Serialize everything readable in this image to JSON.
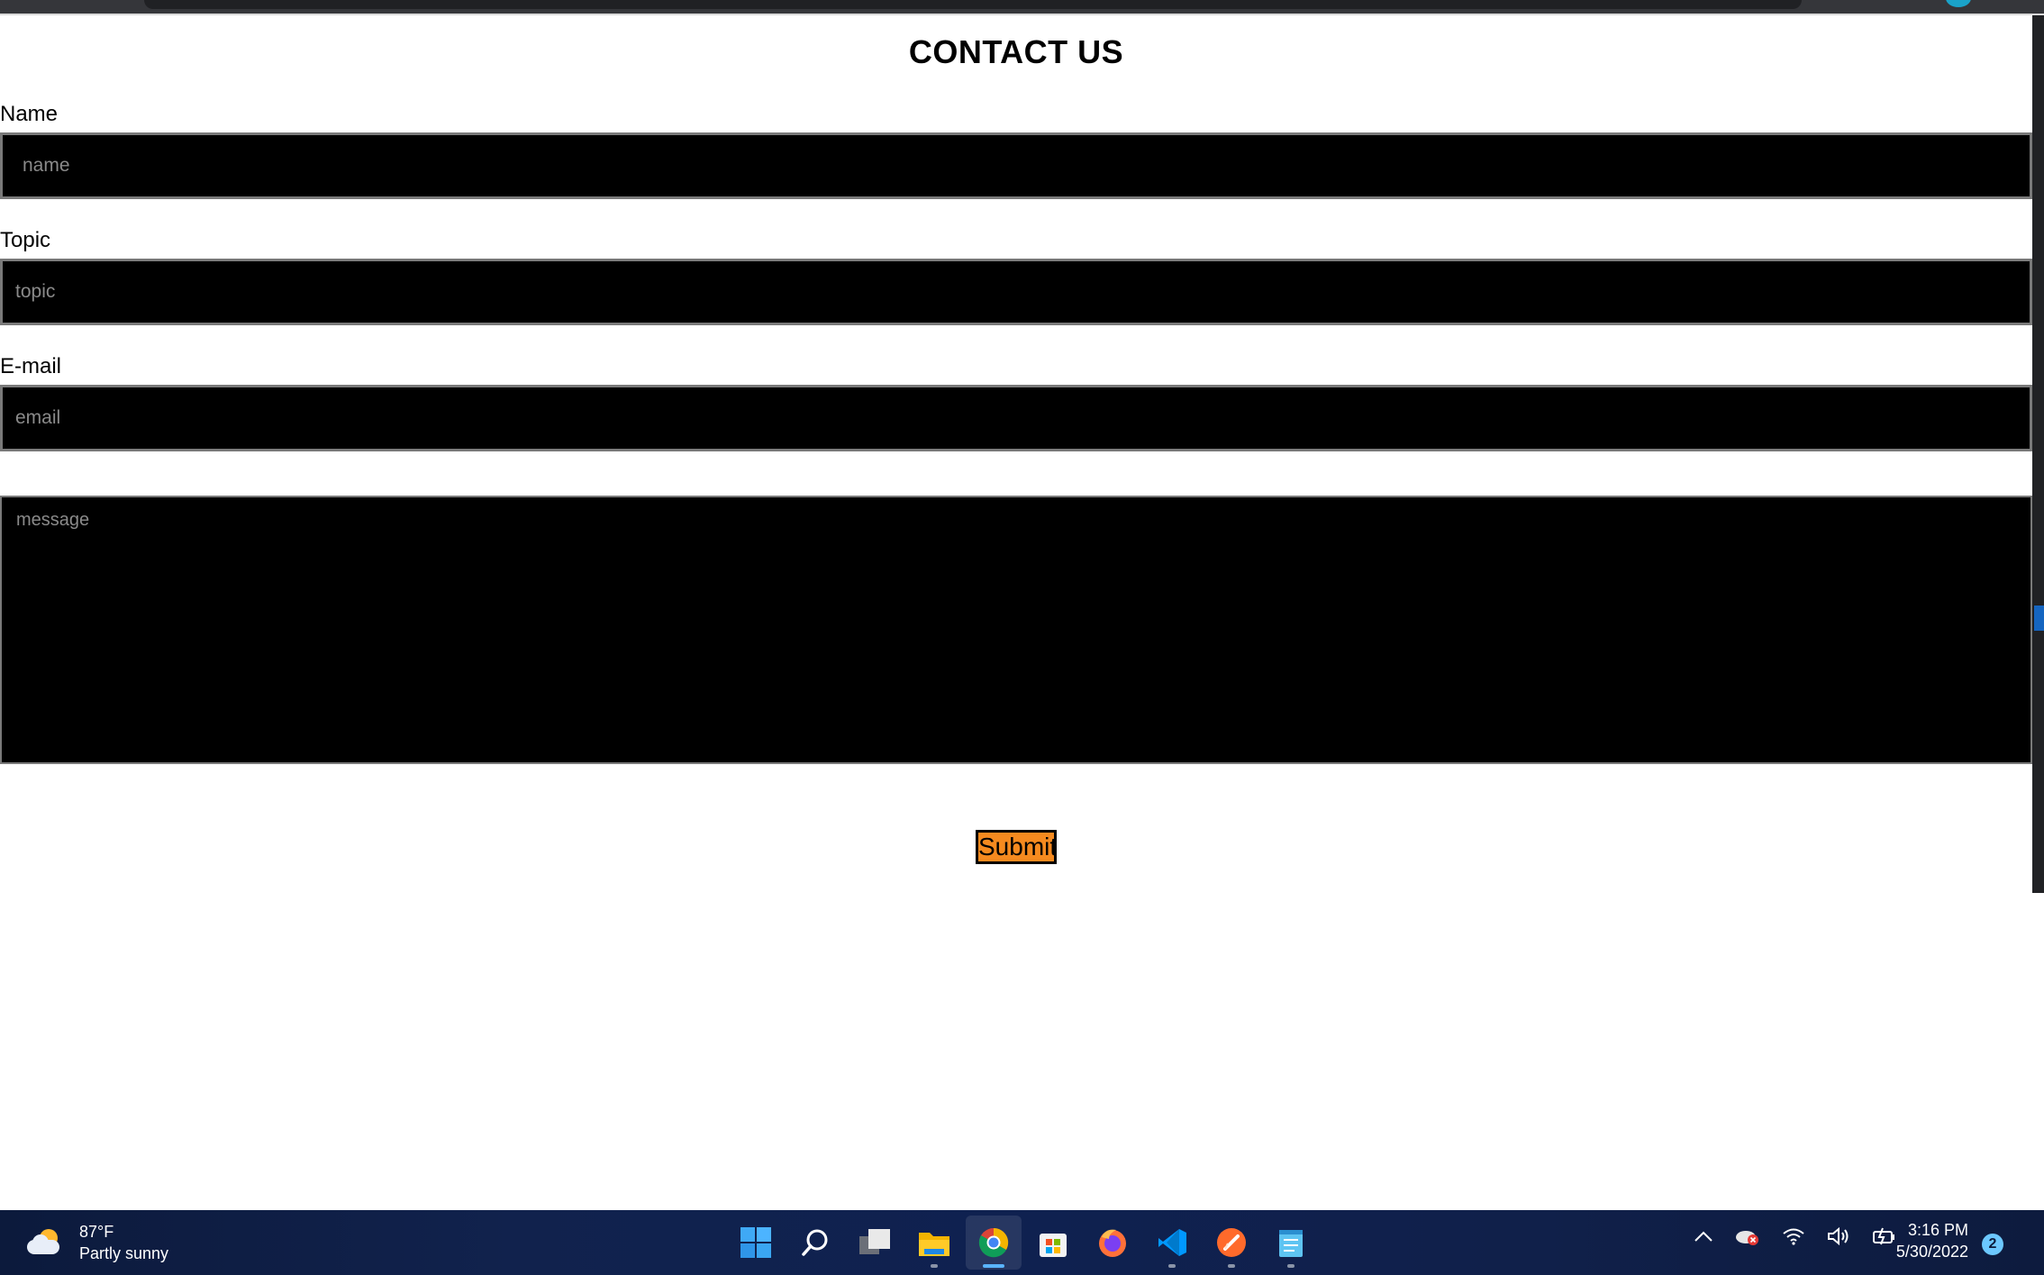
{
  "form": {
    "title": "CONTACT US",
    "name_label": "Name",
    "name_placeholder": "name",
    "topic_label": "Topic",
    "topic_placeholder": "topic",
    "email_label": "E-mail",
    "email_placeholder": "email",
    "message_placeholder": "message",
    "submit_label": "Submit"
  },
  "taskbar": {
    "weather_temp": "87°F",
    "weather_desc": "Partly sunny",
    "apps": [
      "start-icon",
      "search-icon",
      "task-view-icon",
      "file-explorer-icon",
      "chrome-icon",
      "store-icon",
      "firefox-icon",
      "vscode-icon",
      "brave-icon",
      "notepad-icon"
    ],
    "time": "3:16 PM",
    "date": "5/30/2022",
    "notifications": "2"
  },
  "colors": {
    "field_bg": "#000000",
    "submit_bg": "#f58a1f",
    "taskbar_bg": "#0f2150"
  }
}
